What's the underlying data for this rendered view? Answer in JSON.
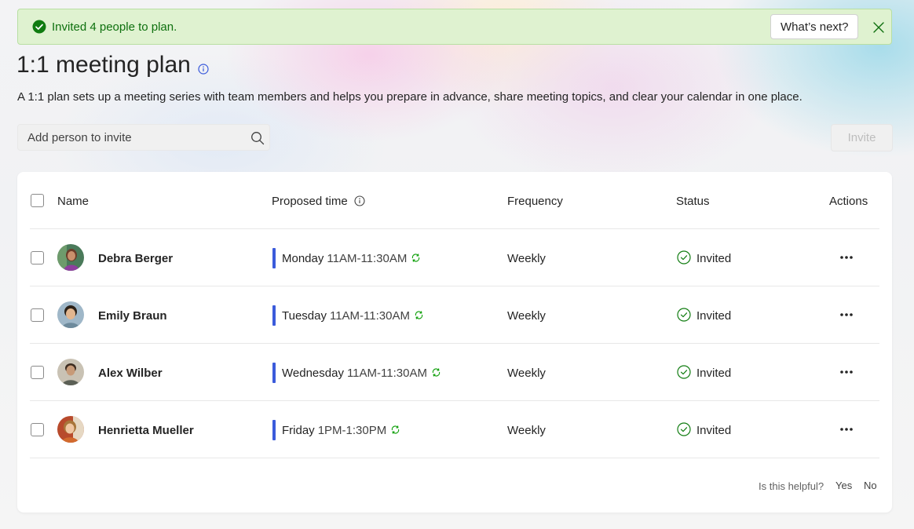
{
  "banner": {
    "message": "Invited 4 people to plan.",
    "whats_next_label": "What’s next?"
  },
  "page": {
    "title": "1:1 meeting plan",
    "description": "A 1:1 plan sets up a meeting series with team members and helps you prepare in advance, share meeting topics, and clear your calendar in one place."
  },
  "search": {
    "placeholder": "Add person to invite"
  },
  "invite_label": "Invite",
  "table": {
    "headers": {
      "name": "Name",
      "proposed_time": "Proposed time",
      "frequency": "Frequency",
      "status": "Status",
      "actions": "Actions"
    },
    "rows": [
      {
        "name": "Debra Berger",
        "day": "Monday",
        "hours": "11AM-11:30AM",
        "frequency": "Weekly",
        "status": "Invited"
      },
      {
        "name": "Emily Braun",
        "day": "Tuesday",
        "hours": "11AM-11:30AM",
        "frequency": "Weekly",
        "status": "Invited"
      },
      {
        "name": "Alex Wilber",
        "day": "Wednesday",
        "hours": "11AM-11:30AM",
        "frequency": "Weekly",
        "status": "Invited"
      },
      {
        "name": "Henrietta Mueller",
        "day": "Friday",
        "hours": "1PM-1:30PM",
        "frequency": "Weekly",
        "status": "Invited"
      }
    ]
  },
  "feedback": {
    "question": "Is this helpful?",
    "yes": "Yes",
    "no": "No"
  },
  "colors": {
    "accent_bar": "#3b5bdb",
    "success_green": "#0e700e",
    "banner_bg": "#dff2d0",
    "recur_green": "#13a10e"
  }
}
